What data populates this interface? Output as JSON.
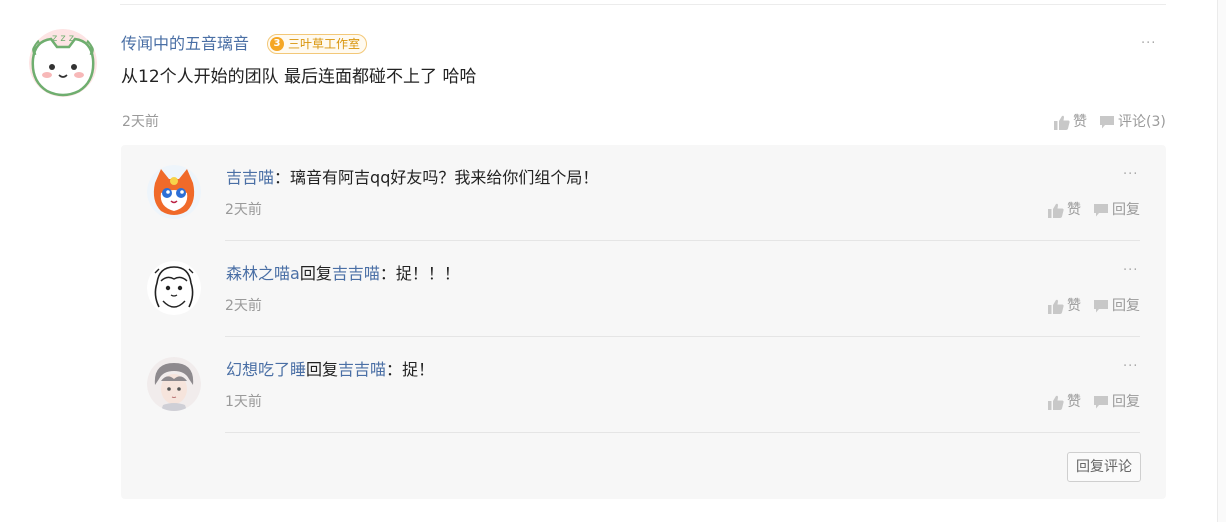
{
  "post": {
    "author": "传闻中的五音璃音",
    "badge": {
      "level": "3",
      "name": "三叶草工作室"
    },
    "more_icon": "···",
    "content": "从12个人开始的团队 最后连面都碰不上了 哈哈",
    "time": "2天前",
    "like_label": "赞",
    "comment_label": "评论(3)"
  },
  "replies": [
    {
      "author": "吉吉喵",
      "reply_word": "",
      "reply_to": "",
      "separator": "：",
      "text": "璃音有阿吉qq好友吗？我来给你们组个局！",
      "time": "2天前",
      "like_label": "赞",
      "reply_label": "回复",
      "more_icon": "···"
    },
    {
      "author": "森林之喵a",
      "reply_word": "回复",
      "reply_to": "吉吉喵",
      "separator": "：",
      "text": "捉！！！",
      "time": "2天前",
      "like_label": "赞",
      "reply_label": "回复",
      "more_icon": "···"
    },
    {
      "author": "幻想吃了睡",
      "reply_word": "回复",
      "reply_to": "吉吉喵",
      "separator": "：",
      "text": "捉！",
      "time": "1天前",
      "like_label": "赞",
      "reply_label": "回复",
      "more_icon": "···"
    }
  ],
  "reply_comment_button": "回复评论",
  "icons": {
    "like": "thumbs-up-icon",
    "comment": "comment-icon",
    "reply": "reply-icon",
    "more": "more-icon"
  },
  "colors": {
    "username": "#4a6fa5",
    "badge": "#d9950b",
    "meta": "#9a9a9a",
    "panel": "#f7f7f7"
  }
}
